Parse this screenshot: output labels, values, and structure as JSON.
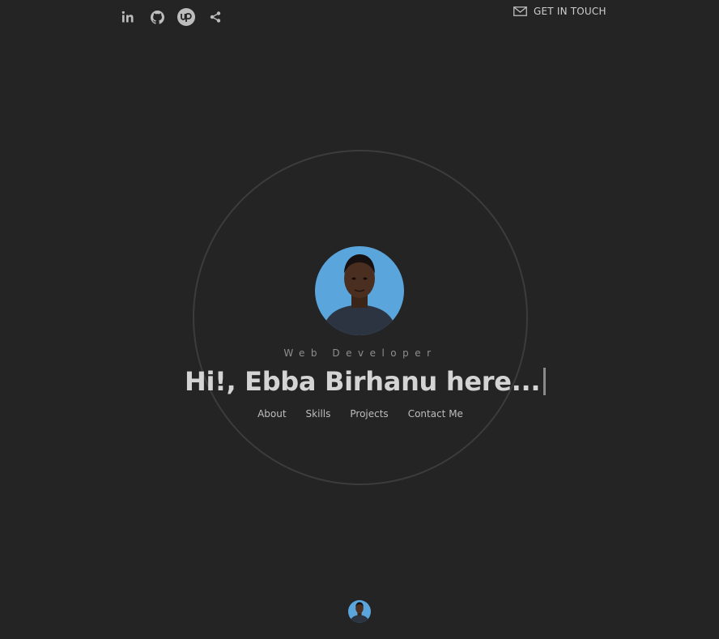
{
  "social": {
    "icons": [
      {
        "name": "linkedin-icon"
      },
      {
        "name": "github-icon"
      },
      {
        "name": "upwork-icon"
      },
      {
        "name": "share-icon"
      }
    ]
  },
  "header": {
    "get_in_touch_label": "GET IN TOUCH",
    "mail_icon": "mail-icon"
  },
  "hero": {
    "role": "Web Developer",
    "greeting": "Hi!, Ebba Birhanu here...",
    "avatar_bg": "#5aa6dc"
  },
  "nav": {
    "items": [
      {
        "label": "About"
      },
      {
        "label": "Skills"
      },
      {
        "label": "Projects"
      },
      {
        "label": "Contact Me"
      }
    ]
  },
  "colors": {
    "background": "#242424",
    "ring": "#3c3c3c",
    "text": "#d4d4d4"
  }
}
